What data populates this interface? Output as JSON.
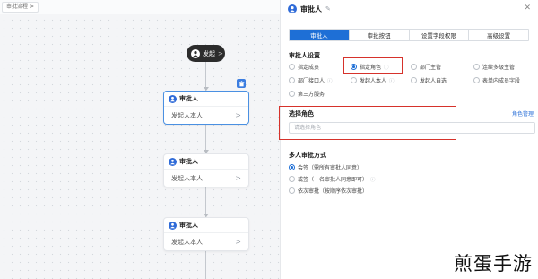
{
  "breadcrumb": {
    "label": "审批流程",
    "chevron": ">"
  },
  "flow": {
    "start_label": "发起",
    "nodes": [
      {
        "title": "审批人",
        "subtitle": "发起人本人",
        "active": true
      },
      {
        "title": "审批人",
        "subtitle": "发起人本人",
        "active": false
      },
      {
        "title": "审批人",
        "subtitle": "发起人本人",
        "active": false
      }
    ]
  },
  "panel": {
    "title": "审批人",
    "tabs": [
      {
        "label": "审批人",
        "active": true
      },
      {
        "label": "审批按钮",
        "active": false
      },
      {
        "label": "设置字段权限",
        "active": false
      },
      {
        "label": "高级设置",
        "active": false
      }
    ],
    "approver_settings": {
      "title": "审批人设置",
      "options": [
        {
          "label": "指定成员",
          "checked": false,
          "info": false
        },
        {
          "label": "指定角色",
          "checked": true,
          "info": true
        },
        {
          "label": "部门主管",
          "checked": false,
          "info": false
        },
        {
          "label": "连续多级主管",
          "checked": false,
          "info": false
        },
        {
          "label": "部门接口人",
          "checked": false,
          "info": true
        },
        {
          "label": "发起人本人",
          "checked": false,
          "info": true
        },
        {
          "label": "发起人自选",
          "checked": false,
          "info": false
        },
        {
          "label": "表单内成员字段",
          "checked": false,
          "info": false
        },
        {
          "label": "第三方服务",
          "checked": false,
          "info": false
        }
      ]
    },
    "select_role": {
      "title": "选择角色",
      "manage_link": "角色管理",
      "placeholder": "请选择角色"
    },
    "multi_approval": {
      "title": "多人审批方式",
      "options": [
        {
          "label": "会签（需所有审批人同意）",
          "checked": true,
          "info": false
        },
        {
          "label": "或签（一名审批人同意即可）",
          "checked": false,
          "info": true
        },
        {
          "label": "依次审批（按顺序依次审批）",
          "checked": false,
          "info": false
        }
      ]
    }
  },
  "watermark": "煎蛋手游",
  "colors": {
    "accent": "#1e6fd6",
    "highlight_box": "#d6322b",
    "start_node_bg": "#2c2c2c"
  }
}
